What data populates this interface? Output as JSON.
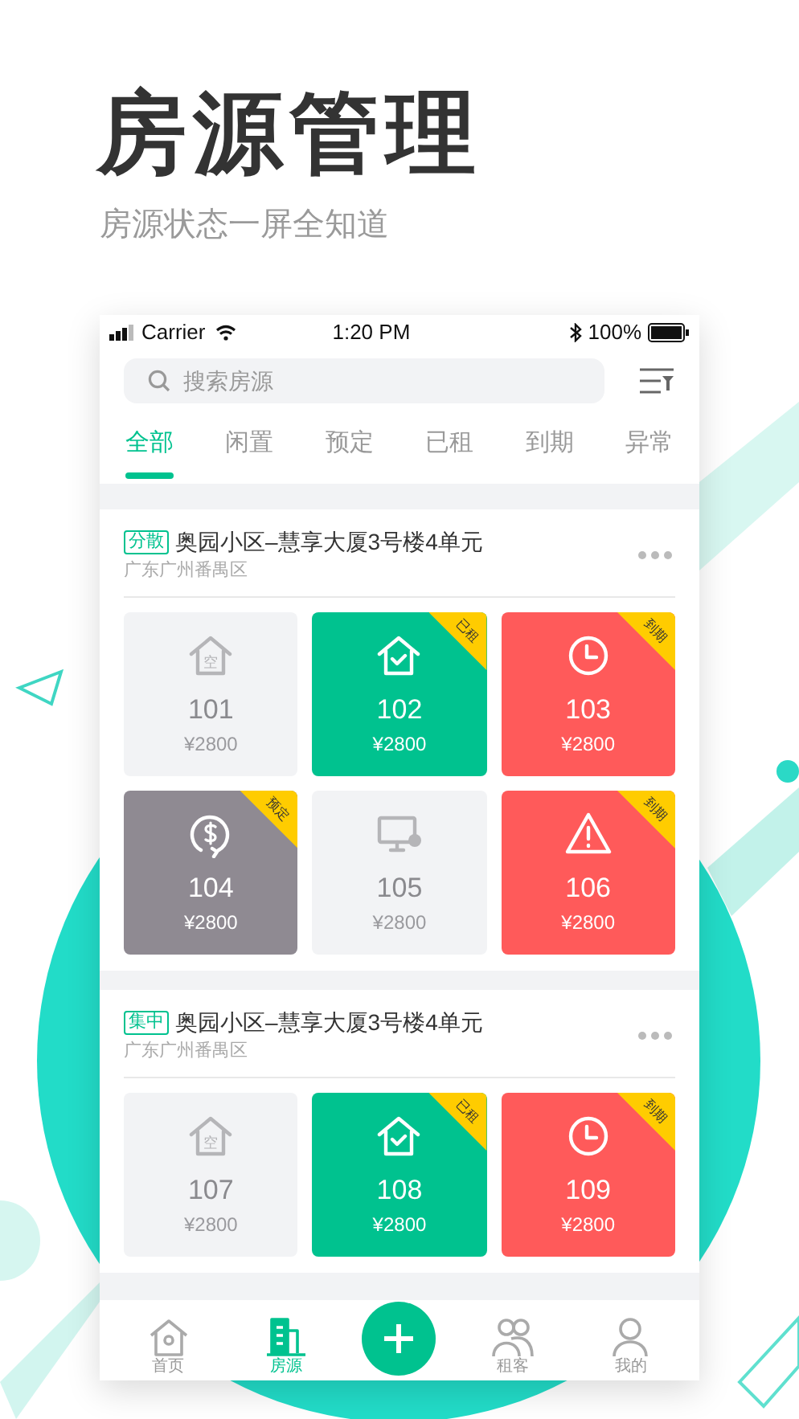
{
  "headline": "房源管理",
  "subtitle": "房源状态一屏全知道",
  "status_bar": {
    "carrier": "Carrier",
    "time": "1:20 PM",
    "battery": "100%"
  },
  "search": {
    "placeholder": "搜索房源"
  },
  "tabs": [
    {
      "label": "全部",
      "selected": true
    },
    {
      "label": "闲置",
      "selected": false
    },
    {
      "label": "预定",
      "selected": false
    },
    {
      "label": "已租",
      "selected": false
    },
    {
      "label": "到期",
      "selected": false
    },
    {
      "label": "异常",
      "selected": false
    }
  ],
  "properties": [
    {
      "tag": "分散",
      "name": "奥园小区–慧享大厦3号楼4单元",
      "location": "广东广州番禺区",
      "units": [
        {
          "kind": "vacant",
          "room": "101",
          "rent": "¥2800",
          "icon_label": "空"
        },
        {
          "kind": "rented",
          "room": "102",
          "rent": "¥2800",
          "badge": "已租"
        },
        {
          "kind": "expiring",
          "room": "103",
          "rent": "¥2800",
          "badge": "到期"
        },
        {
          "kind": "reserved",
          "room": "104",
          "rent": "¥2800",
          "badge": "预定"
        },
        {
          "kind": "offline",
          "room": "105",
          "rent": "¥2800"
        },
        {
          "kind": "abnormal",
          "room": "106",
          "rent": "¥2800",
          "badge": "到期"
        }
      ]
    },
    {
      "tag": "集中",
      "name": "奥园小区–慧享大厦3号楼4单元",
      "location": "广东广州番禺区",
      "units": [
        {
          "kind": "vacant",
          "room": "107",
          "rent": "¥2800",
          "icon_label": "空"
        },
        {
          "kind": "rented",
          "room": "108",
          "rent": "¥2800",
          "badge": "已租"
        },
        {
          "kind": "expiring",
          "room": "109",
          "rent": "¥2800",
          "badge": "到期"
        }
      ]
    }
  ],
  "nav": [
    {
      "kind": "home",
      "label": "首页",
      "selected": false
    },
    {
      "kind": "building",
      "label": "房源",
      "selected": true
    },
    {
      "kind": "add"
    },
    {
      "kind": "people",
      "label": "租客",
      "selected": false
    },
    {
      "kind": "person",
      "label": "我的",
      "selected": false
    }
  ]
}
